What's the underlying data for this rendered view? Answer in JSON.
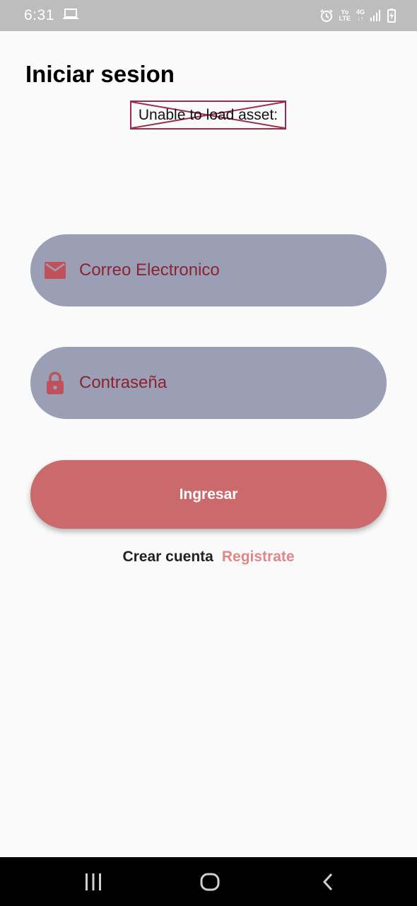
{
  "status_bar": {
    "time": "6:31",
    "network_top": "Yo",
    "network_bottom": "LTE",
    "network_type": "4G",
    "icons": [
      "laptop-icon",
      "alarm-icon",
      "volte-icon",
      "signal-icon",
      "battery-charging-icon"
    ]
  },
  "page": {
    "title": "Iniciar sesion",
    "asset_error": "Unable to load asset:"
  },
  "form": {
    "email_placeholder": "Correo Electronico",
    "password_placeholder": "Contraseña",
    "login_label": "Ingresar",
    "create_account_text": "Crear cuenta",
    "register_link": "Registrate"
  },
  "colors": {
    "field_background": "#9a9fb6",
    "placeholder_text": "#8b2330",
    "icon": "#c0505a",
    "button": "#cb6a6c",
    "link": "#e08686"
  },
  "nav_bar": {
    "icons": [
      "recent-apps-icon",
      "home-icon",
      "back-icon"
    ]
  }
}
